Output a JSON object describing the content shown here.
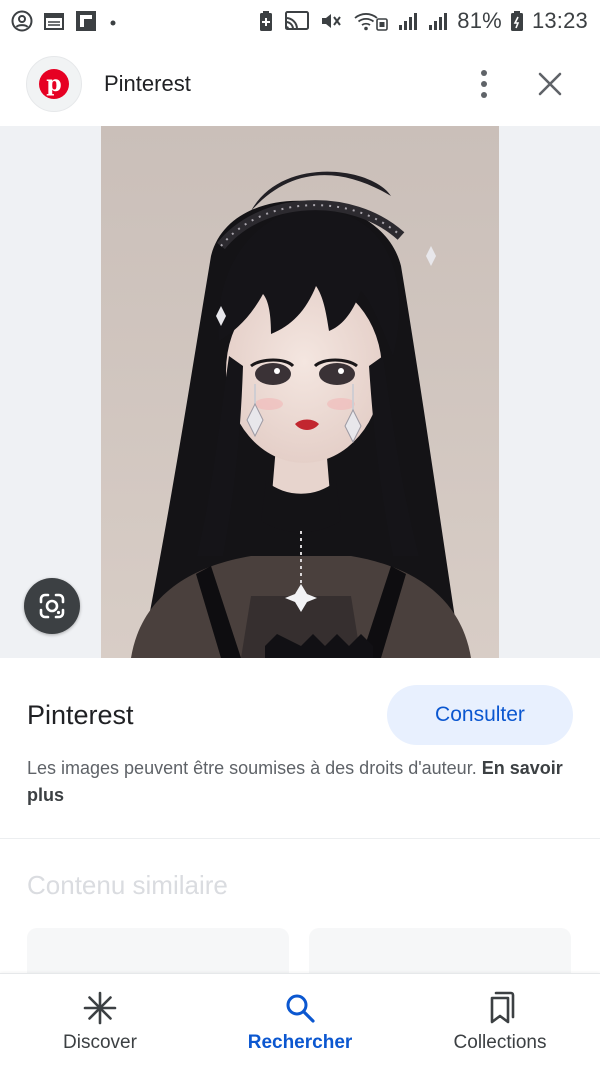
{
  "status_bar": {
    "battery": "81%",
    "time": "13:23",
    "icons_left": [
      "account-circle-icon",
      "calendar-icon",
      "flipboard-icon",
      "dot-icon"
    ],
    "icons_right": [
      "battery-saver-icon",
      "cast-icon",
      "mute-icon",
      "wifi-icon",
      "signal-icon",
      "signal-icon",
      "battery-icon"
    ]
  },
  "header": {
    "title": "Pinterest",
    "logo_letter": "p",
    "brand_color": "#e60023"
  },
  "image": {
    "lens_icon": "google-lens-icon"
  },
  "result": {
    "source": "Pinterest",
    "consult_label": "Consulter",
    "copyright_text": "Les images peuvent être soumises à des droits d'auteur. ",
    "learn_more": "En savoir plus"
  },
  "similar": {
    "title": "Contenu similaire"
  },
  "bottom_nav": {
    "items": [
      {
        "label": "Discover",
        "icon": "asterisk-icon",
        "active": false
      },
      {
        "label": "Rechercher",
        "icon": "search-icon",
        "active": true
      },
      {
        "label": "Collections",
        "icon": "bookmark-icon",
        "active": false
      }
    ]
  },
  "colors": {
    "accent": "#0b57d0",
    "consult_bg": "#e8f0fe",
    "image_bg": "#eff1f4"
  }
}
